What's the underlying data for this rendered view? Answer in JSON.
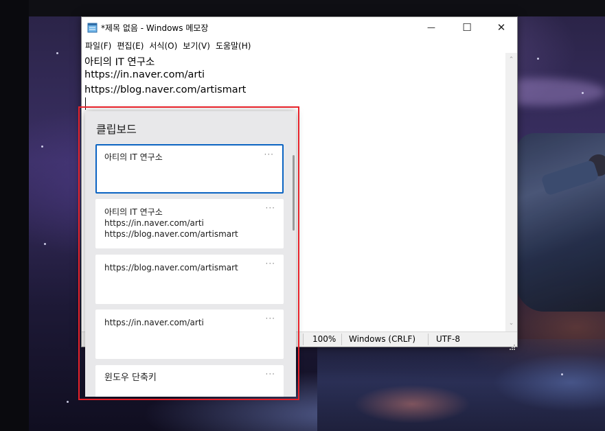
{
  "notepad": {
    "title": "*제목 없음 - Windows 메모장",
    "menu": [
      "파일(F)",
      "편집(E)",
      "서식(O)",
      "보기(V)",
      "도움말(H)"
    ],
    "lines": [
      "아티의 IT 연구소",
      "https://in.naver.com/arti",
      "https://blog.naver.com/artismart"
    ],
    "status": {
      "zoom": "100%",
      "line_ending": "Windows (CRLF)",
      "encoding": "UTF-8"
    },
    "window_buttons": {
      "minimize": "—",
      "maximize": "☐",
      "close": "✕"
    }
  },
  "clipboard": {
    "title": "클립보드",
    "more_glyph": "···",
    "items": [
      {
        "lines": [
          "아티의 IT 연구소"
        ],
        "selected": true
      },
      {
        "lines": [
          "아티의 IT 연구소",
          "https://in.naver.com/arti",
          "https://blog.naver.com/artismart"
        ],
        "selected": false
      },
      {
        "lines": [
          "https://blog.naver.com/artismart"
        ],
        "selected": false
      },
      {
        "lines": [
          "https://in.naver.com/arti"
        ],
        "selected": false
      },
      {
        "lines": [
          "윈도우 단축키"
        ],
        "selected": false
      }
    ]
  },
  "colors": {
    "highlight": "#e8222a",
    "selection": "#0a63c2"
  },
  "icons": {
    "app": "notepad-icon"
  }
}
